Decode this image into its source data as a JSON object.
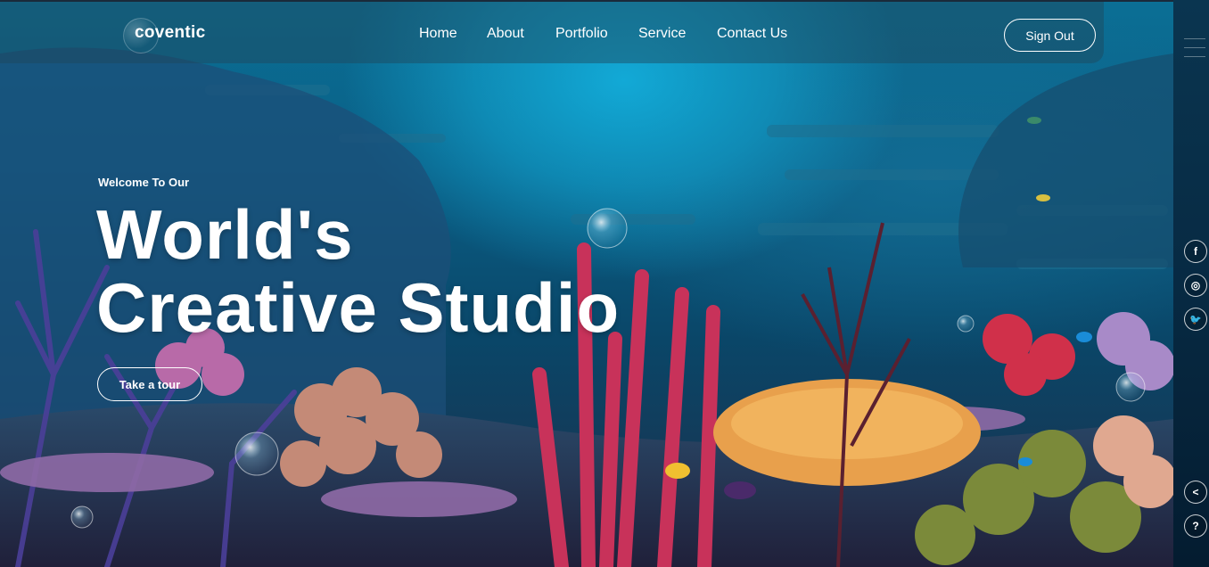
{
  "brand": {
    "logo": "coventic"
  },
  "nav": {
    "items": [
      "Home",
      "About",
      "Portfolio",
      "Service",
      "Contact Us"
    ],
    "sign_out": "Sign Out"
  },
  "hero": {
    "kicker": "Welcome To Our",
    "title_line1": "World's",
    "title_line2": "Creative Studio",
    "cta": "Take a tour"
  },
  "sidebar": {
    "social": [
      {
        "icon": "facebook-icon",
        "glyph": "f"
      },
      {
        "icon": "instagram-icon",
        "glyph": "◎"
      },
      {
        "icon": "twitter-icon",
        "glyph": "🐦"
      }
    ],
    "share_glyph": "<",
    "help_glyph": "?"
  },
  "colors": {
    "water_light": "#12a9d6",
    "water_dark": "#0a4668",
    "coral_red": "#d33a5c",
    "coral_orange": "#f0a050",
    "sidebar": "#072a43"
  }
}
